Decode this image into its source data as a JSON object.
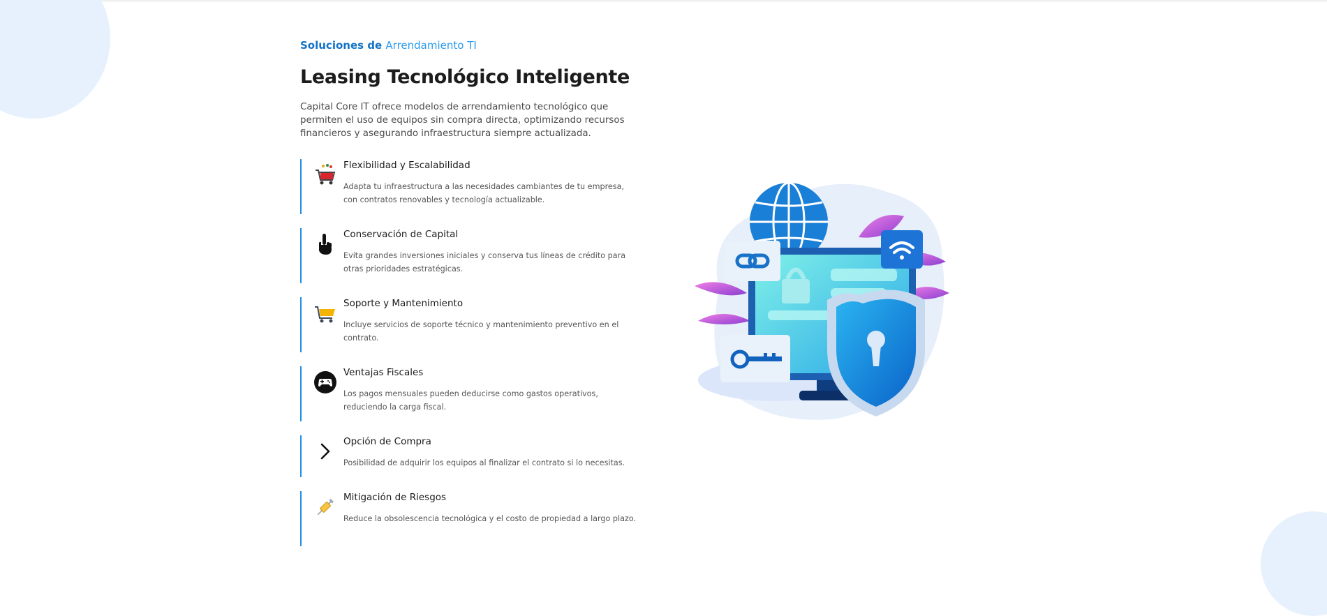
{
  "section": {
    "eyebrow_prefix": "Soluciones de",
    "eyebrow_accent": "Arrendamiento TI",
    "title": "Leasing Tecnológico Inteligente",
    "description": "Capital Core IT ofrece modelos de arrendamiento tecnológico que permiten el uso de equipos sin compra directa, optimizando recursos financieros y asegurando infraestructura siempre actualizada."
  },
  "features": [
    {
      "title": "Flexibilidad y Escalabilidad",
      "description": "Adapta tu infraestructura a las necesidades cambiantes de tu empresa, con contratos renovables y tecnología actualizable.",
      "icon": "shopping-cart-red-icon"
    },
    {
      "title": "Conservación de Capital",
      "description": "Evita grandes inversiones iniciales y conserva tus líneas de crédito para otras prioridades estratégicas.",
      "icon": "pointing-hand-icon"
    },
    {
      "title": "Soporte y Mantenimiento",
      "description": "Incluye servicios de soporte técnico y mantenimiento preventivo en el contrato.",
      "icon": "shopping-cart-yellow-icon"
    },
    {
      "title": "Ventajas Fiscales",
      "description": "Los pagos mensuales pueden deducirse como gastos operativos, reduciendo la carga fiscal.",
      "icon": "gamepad-icon"
    },
    {
      "title": "Opción de Compra",
      "description": "Posibilidad de adquirir los equipos al finalizar el contrato si lo necesitas.",
      "icon": "chevron-right-icon"
    },
    {
      "title": "Mitigación de Riesgos",
      "description": "Reduce la obsolescencia tecnológica y el costo de propiedad a largo plazo.",
      "icon": "syringe-icon"
    }
  ],
  "illustration": {
    "icon": "cybersecurity-illustration"
  },
  "colors": {
    "accent": "#1f8fe6",
    "brand": "#1273c6",
    "blob": "#e6f1fd"
  }
}
